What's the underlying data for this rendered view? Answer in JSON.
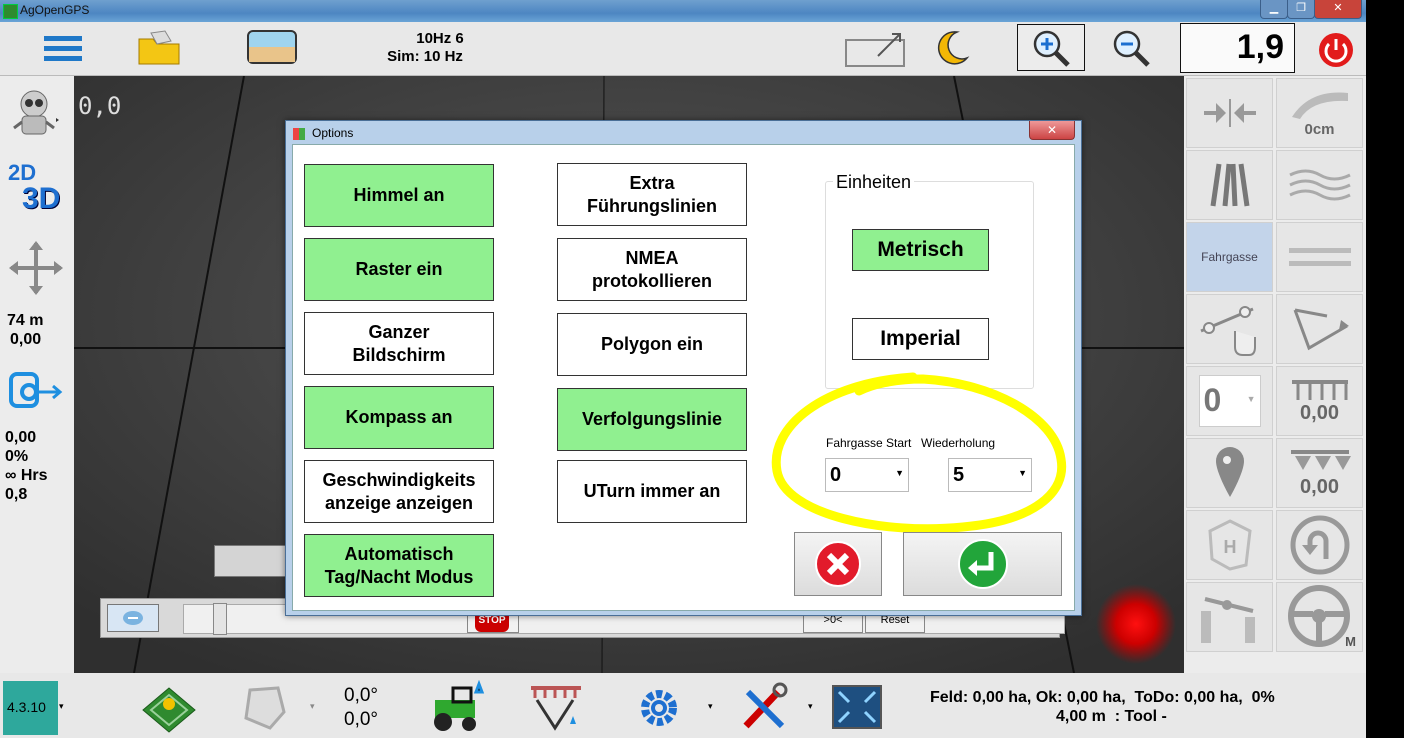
{
  "window": {
    "title": "AgOpenGPS",
    "minimize": "▁",
    "maximize": "❐",
    "close": "✕"
  },
  "toolbar": {
    "hz_line1": "10Hz 6",
    "hz_line2": "Sim: 10 Hz",
    "zoom_value": "1,9",
    "icons": [
      "menu-icon",
      "field-folder-icon",
      "sky-view-icon",
      "fullscreen-toggle-icon",
      "night-mode-icon",
      "zoom-in-icon",
      "zoom-out-icon",
      "power-icon"
    ]
  },
  "map": {
    "coords": "0,0"
  },
  "left": {
    "mode_2d": "2D",
    "mode_3d": "3D",
    "distance": "74 m",
    "distance_sub": "0,00",
    "stat1": "0,00",
    "stat2": "0%",
    "stat3": "∞ Hrs",
    "stat4": "0,8"
  },
  "right": {
    "offset": "0cm",
    "tramline": "Fahrgasse",
    "zero_select": "0",
    "section_width1": "0,00",
    "section_width2": "0,00",
    "steer_mode": "M"
  },
  "bottom": {
    "version": "4.3.10",
    "heading1": "0,0°",
    "heading2": "0,0°",
    "field_info": "Feld: 0,00 ha, Ok: 0,00 ha,  ToDo: 0,00 ha,  0%",
    "tool_info": "4,00 m  : Tool -"
  },
  "background_controls": {
    "stop": "STOP",
    "zero": ">0<",
    "reset": "Reset"
  },
  "dialog": {
    "title": "Options",
    "close": "✕",
    "col1": [
      {
        "label": "Himmel an",
        "on": true
      },
      {
        "label": "Raster ein",
        "on": true
      },
      {
        "label": "Ganzer\nBildschirm",
        "on": false
      },
      {
        "label": "Kompass an",
        "on": true
      },
      {
        "label": "Geschwindigkeits\nanzeige anzeigen",
        "on": false
      },
      {
        "label": "Automatisch\nTag/Nacht Modus",
        "on": true
      }
    ],
    "col2": [
      {
        "label": "Extra\nFührungslinien",
        "on": false
      },
      {
        "label": "NMEA\nprotokollieren",
        "on": false
      },
      {
        "label": "Polygon ein",
        "on": false
      },
      {
        "label": "Verfolgungslinie",
        "on": true
      },
      {
        "label": "UTurn immer an",
        "on": false
      }
    ],
    "units_group": "Einheiten",
    "metric": "Metrisch",
    "imperial": "Imperial",
    "tram_start_label": "Fahrgasse Start",
    "tram_start_value": "0",
    "repeat_label": "Wiederholung",
    "repeat_value": "5",
    "highlight_color": "#ffff00"
  }
}
